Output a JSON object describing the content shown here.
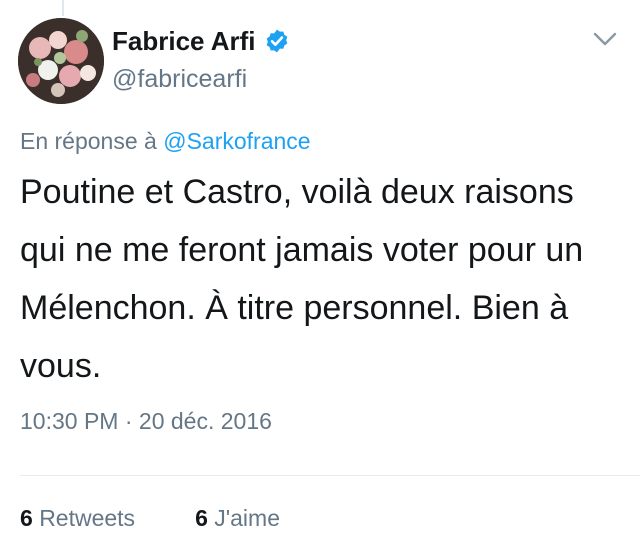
{
  "user": {
    "display_name": "Fabrice Arfi",
    "handle": "@fabricearfi",
    "verified": true,
    "verified_color": "#1da1f2"
  },
  "reply": {
    "prefix": "En réponse à",
    "mention": "@Sarkofrance"
  },
  "tweet": {
    "text": "Poutine et Castro, voilà deux raisons qui ne me feront jamais voter pour un Mélenchon. À titre personnel. Bien à vous.",
    "time": "10:30 PM",
    "separator": "·",
    "date": "20 déc. 2016"
  },
  "stats": {
    "retweets_count": "6",
    "retweets_label": "Retweets",
    "likes_count": "6",
    "likes_label": "J'aime"
  },
  "icons": {
    "verified": "verified-badge-icon",
    "menu": "chevron-down-icon"
  },
  "colors": {
    "link": "#1da1f2",
    "secondary_text": "#657786",
    "primary_text": "#14171a"
  }
}
